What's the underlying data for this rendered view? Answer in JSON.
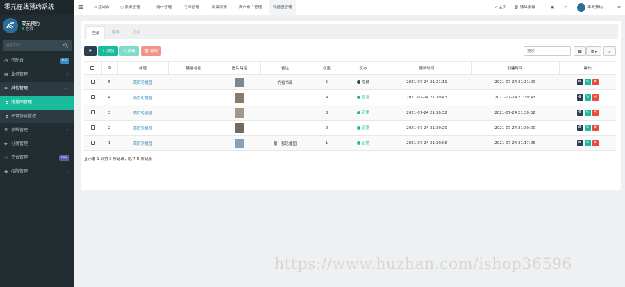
{
  "app": {
    "title": "零元在线预约系统"
  },
  "user": {
    "name": "零元预约",
    "status": "在线"
  },
  "sidebar": {
    "search_placeholder": "搜索菜单...",
    "items": [
      {
        "label": "控制台",
        "icon": "dashboard-icon",
        "badge": "hot",
        "badge_color": "#3c8dbc"
      },
      {
        "label": "业务管理",
        "icon": "briefcase-icon",
        "arrow": "‹"
      },
      {
        "label": "其他管理",
        "icon": "list-icon",
        "arrow": "⌄",
        "open": true
      },
      {
        "label": "轮播图管理",
        "icon": "circle-icon",
        "sub": true,
        "active": true
      },
      {
        "label": "平台协议管理",
        "icon": "circle-icon",
        "sub": true
      },
      {
        "label": "系统管理",
        "icon": "cogs-icon",
        "arrow": "‹"
      },
      {
        "label": "分类管理",
        "icon": "tags-icon"
      },
      {
        "label": "平台管理",
        "icon": "plugin-icon",
        "badge": "new",
        "badge_color": "#605ca8"
      },
      {
        "label": "权限管理",
        "icon": "group-icon",
        "arrow": "‹"
      }
    ]
  },
  "topnav": {
    "tabs": [
      "控制台",
      "服务管理",
      "用户管理",
      "订单管理",
      "发票列表",
      "商户推广管理",
      "轮播图管理"
    ],
    "home": "主页",
    "clear_cache": "清除缓存",
    "user": "零元预约"
  },
  "subtabs": [
    "全部",
    "隐藏",
    "正常"
  ],
  "toolbar": {
    "refresh": "⟳",
    "add": "+ 添加",
    "edit": "✎ 编辑",
    "delete": "🗑 删除",
    "search_placeholder": "搜索"
  },
  "table": {
    "headers": [
      "",
      "ID",
      "标题",
      "链接地址",
      "图片路径",
      "备注",
      "权重",
      "状态",
      "更新时间",
      "创建时间",
      "操作"
    ],
    "rows": [
      {
        "id": "5",
        "title": "首页轮播图",
        "link": "",
        "remark": "的看书局",
        "weight": "5",
        "status": "隐藏",
        "status_color": "#2c3e50",
        "updated": "2021-07-24 21:31:11",
        "created": "2021-07-24 21:31:00",
        "thumb": "#7a8a90"
      },
      {
        "id": "4",
        "title": "首页轮播图",
        "link": "",
        "remark": "",
        "weight": "4",
        "status": "正常",
        "status_color": "#18bc9c",
        "updated": "2021-07-24 21:30:43",
        "created": "2021-07-24 21:30:43",
        "thumb": "#8b7a6a"
      },
      {
        "id": "3",
        "title": "首页轮播图",
        "link": "",
        "remark": "",
        "weight": "3",
        "status": "正常",
        "status_color": "#18bc9c",
        "updated": "2021-07-24 21:30:32",
        "created": "2021-07-24 21:30:32",
        "thumb": "#a29888"
      },
      {
        "id": "2",
        "title": "首页轮播图",
        "link": "",
        "remark": "",
        "weight": "2",
        "status": "正常",
        "status_color": "#18bc9c",
        "updated": "2021-07-24 21:30:20",
        "created": "2021-07-24 21:30:20",
        "thumb": "#6f6a66"
      },
      {
        "id": "1",
        "title": "首页轮播图",
        "link": "",
        "remark": "第一张轮播图",
        "weight": "1",
        "status": "正常",
        "status_color": "#18bc9c",
        "updated": "2021-07-24 21:30:06",
        "created": "2021-07-24 21:17:25",
        "thumb": "#8aa0b4"
      }
    ]
  },
  "footer": {
    "info": "显示第 1 到第 5 条记录，总共 5 条记录"
  },
  "watermark": "https://www.huzhan.com/ishop36596"
}
